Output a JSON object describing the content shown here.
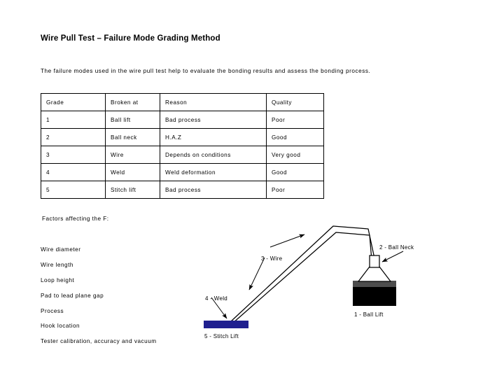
{
  "slide": {
    "title": "Wire Pull Test – Failure Mode Grading Method",
    "intro": "The failure modes used in the wire pull test help to evaluate the bonding results and assess the bonding process."
  },
  "table": {
    "headers": [
      "Grade",
      "Broken at",
      "Reason",
      "Quality"
    ],
    "rows": [
      {
        "grade": "1",
        "broken_at": "Ball lift",
        "reason": "Bad process",
        "quality": "Poor"
      },
      {
        "grade": "2",
        "broken_at": "Ball neck",
        "reason": "H.A.Z",
        "quality": "Good"
      },
      {
        "grade": "3",
        "broken_at": "Wire",
        "reason": "Depends on conditions",
        "quality": "Very good"
      },
      {
        "grade": "4",
        "broken_at": "Weld",
        "reason": "Weld deformation",
        "quality": "Good"
      },
      {
        "grade": "5",
        "broken_at": "Stitch lift",
        "reason": "Bad process",
        "quality": "Poor"
      }
    ]
  },
  "factors": {
    "heading": "Factors affecting the F:",
    "items": [
      "Wire diameter",
      "Wire length",
      "Loop height",
      "Pad to lead plane gap",
      "Process",
      "Hook location",
      "Tester calibration, accuracy and vacuum"
    ]
  },
  "diagram": {
    "labels": {
      "ball_lift": "1 - Ball Lift",
      "ball_neck": "2 - Ball Neck",
      "wire": "3 - Wire",
      "weld": "4 - Weld",
      "stitch_lift": "5 - Stitch Lift"
    },
    "colors": {
      "stitch_bar": "#1f1f8f",
      "die_block": "#000000",
      "pad_layer": "#4d4d4d",
      "outline": "#000000",
      "background": "#ffffff"
    }
  }
}
